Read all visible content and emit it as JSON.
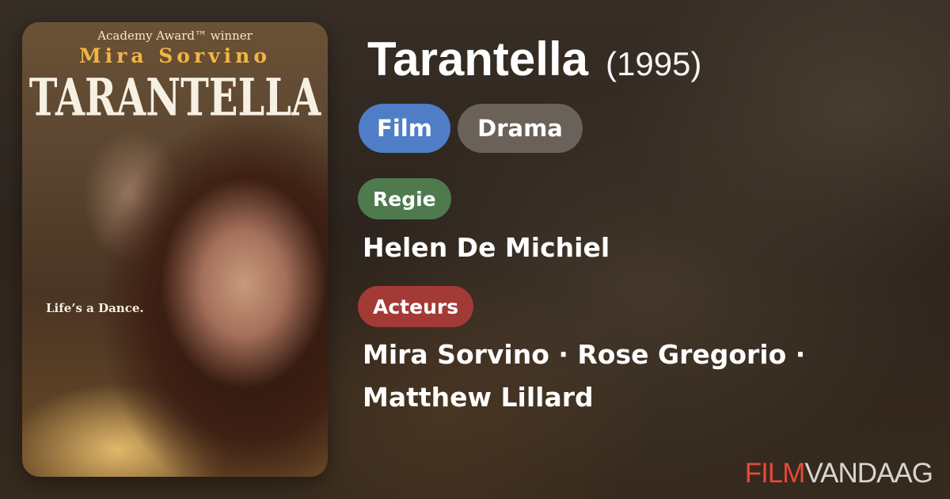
{
  "poster": {
    "award_line": "Academy Award™ winner",
    "star": "Mira Sorvino",
    "title": "TARANTELLA",
    "tagline": "Life’s a Dance."
  },
  "movie": {
    "title": "Tarantella",
    "year": "(1995)"
  },
  "chips": [
    {
      "label": "Film",
      "color": "#4f7ec7"
    },
    {
      "label": "Drama",
      "color": "#78706a"
    }
  ],
  "sections": {
    "director_label": "Regie",
    "director": "Helen De Michiel",
    "actors_label": "Acteurs",
    "actors": "Mira Sorvino · Rose Gregorio · Matthew Lillard"
  },
  "brand": {
    "part1": "FILM",
    "part2": "VANDAAG",
    "accent": "#e24b3a"
  }
}
